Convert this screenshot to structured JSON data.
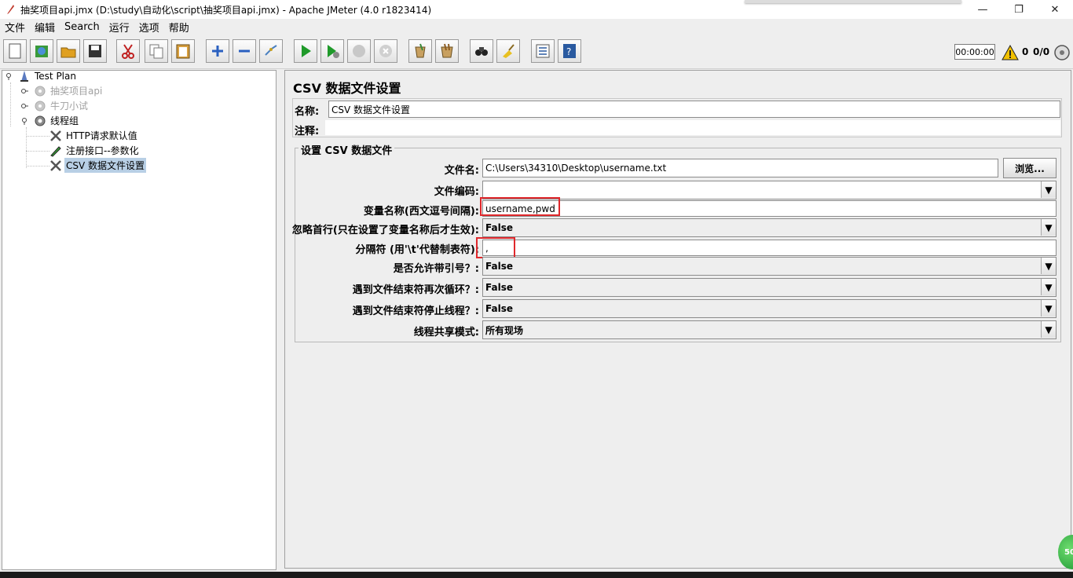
{
  "window": {
    "title": "抽奖项目api.jmx (D:\\study\\自动化\\script\\抽奖项目api.jmx) - Apache JMeter (4.0 r1823414)"
  },
  "menu": [
    "文件",
    "编辑",
    "Search",
    "运行",
    "选项",
    "帮助"
  ],
  "toolbar": {
    "buttons": [
      "new-icon",
      "templates-icon",
      "open-icon",
      "save-icon",
      "cut-icon",
      "copy-icon",
      "paste-icon",
      "expand-icon",
      "collapse-icon",
      "toggle-icon",
      "start-icon",
      "start-no-pause-icon",
      "stop-icon",
      "shutdown-icon",
      "clear-icon",
      "clear-all-icon",
      "search-icon",
      "reset-search-icon",
      "function-helper-icon",
      "help-icon"
    ],
    "timer": "00:00:00",
    "warnings": "0",
    "threads": "0/0"
  },
  "tree": [
    {
      "label": "Test Plan",
      "icon": "test-plan-icon",
      "disabled": false,
      "selected": false
    },
    {
      "label": "抽奖项目api",
      "icon": "gear-icon",
      "disabled": true,
      "selected": false
    },
    {
      "label": "牛刀小试",
      "icon": "gear-icon",
      "disabled": true,
      "selected": false
    },
    {
      "label": "线程组",
      "icon": "gear-icon",
      "disabled": false,
      "selected": false
    },
    {
      "label": "HTTP请求默认值",
      "icon": "wrench-icon",
      "disabled": false,
      "selected": false
    },
    {
      "label": "注册接口--参数化",
      "icon": "pencil-icon",
      "disabled": false,
      "selected": false
    },
    {
      "label": "CSV 数据文件设置",
      "icon": "wrench-icon",
      "disabled": false,
      "selected": true
    }
  ],
  "panel": {
    "title": "CSV 数据文件设置",
    "name_label": "名称:",
    "name_value": "CSV 数据文件设置",
    "comment_label": "注释:",
    "comment_value": "",
    "group_title": "设置 CSV 数据文件",
    "filename_label": "文件名:",
    "filename_value": "C:\\Users\\34310\\Desktop\\username.txt",
    "browse_label": "浏览...",
    "encoding_label": "文件编码:",
    "encoding_value": "",
    "varnames_label": "变量名称(西文逗号间隔):",
    "varnames_value": "username,pwd",
    "ignore_first_label": "忽略首行(只在设置了变量名称后才生效):",
    "ignore_first_value": "False",
    "delimiter_label": "分隔符 (用'\\t'代替制表符):",
    "delimiter_value": ",",
    "quoted_label": "是否允许带引号？:",
    "quoted_value": "False",
    "recycle_label": "遇到文件结束符再次循环？:",
    "recycle_value": "False",
    "stop_label": "遇到文件结束符停止线程？:",
    "stop_value": "False",
    "sharing_label": "线程共享模式:",
    "sharing_value": "所有现场"
  },
  "badge": "50",
  "colors": {
    "highlight": "#e0282c",
    "selection": "#b8cfe5"
  }
}
